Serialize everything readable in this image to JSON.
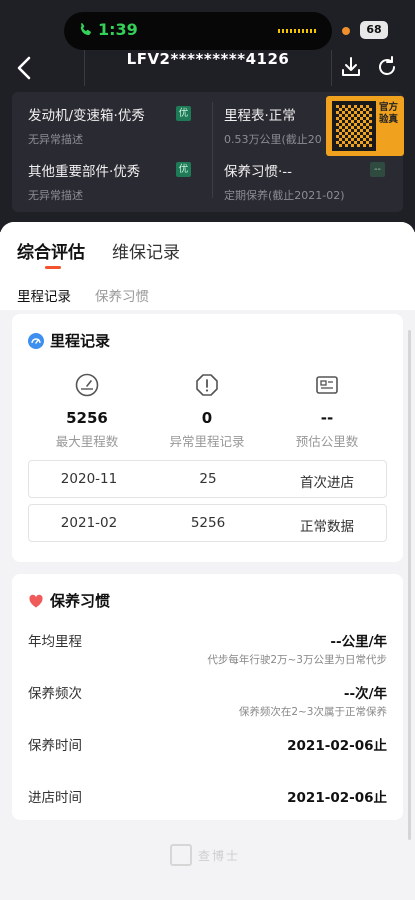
{
  "status_bar": {
    "time": "1:39",
    "battery": "68"
  },
  "header": {
    "plate": "LFV2*********4126"
  },
  "summary": {
    "items": [
      {
        "title": "发动机/变速箱·优秀",
        "desc": "无异常描述",
        "badge": "优"
      },
      {
        "title": "里程表·正常",
        "desc": "0.53万公里(截止20",
        "badge": ""
      },
      {
        "title": "其他重要部件·优秀",
        "desc": "无异常描述",
        "badge": "优"
      },
      {
        "title": "保养习惯·--",
        "desc": "定期保养(截止2021-02)",
        "badge": "--"
      }
    ],
    "qr_label": "官方验真"
  },
  "tabs": [
    {
      "label": "综合评估"
    },
    {
      "label": "维保记录"
    }
  ],
  "subtabs": [
    {
      "label": "里程记录"
    },
    {
      "label": "保养习惯"
    }
  ],
  "mileage": {
    "title": "里程记录",
    "metrics": [
      {
        "value": "5256",
        "label": "最大里程数",
        "icon": "gauge-icon"
      },
      {
        "value": "0",
        "label": "异常里程记录",
        "icon": "warning-icon"
      },
      {
        "value": "--",
        "label": "预估公里数",
        "icon": "id-card-icon"
      }
    ],
    "records": [
      {
        "date": "2020-11",
        "km": "25",
        "type": "首次进店"
      },
      {
        "date": "2021-02",
        "km": "5256",
        "type": "正常数据"
      }
    ]
  },
  "habits": {
    "title": "保养习惯",
    "items": [
      {
        "key": "年均里程",
        "value": "--公里/年",
        "note": "代步每年行驶2万~3万公里为日常代步"
      },
      {
        "key": "保养频次",
        "value": "--次/年",
        "note": "保养频次在2~3次属于正常保养"
      },
      {
        "key": "保养时间",
        "value": "2021-02-06止",
        "note": ""
      },
      {
        "key": "进店时间",
        "value": "2021-02-06止",
        "note": ""
      }
    ]
  },
  "footer": {
    "brand": "查博士"
  },
  "colors": {
    "accent": "#f2522e",
    "header_bg": "#1f1f26",
    "badge_green": "#1e7a57"
  }
}
